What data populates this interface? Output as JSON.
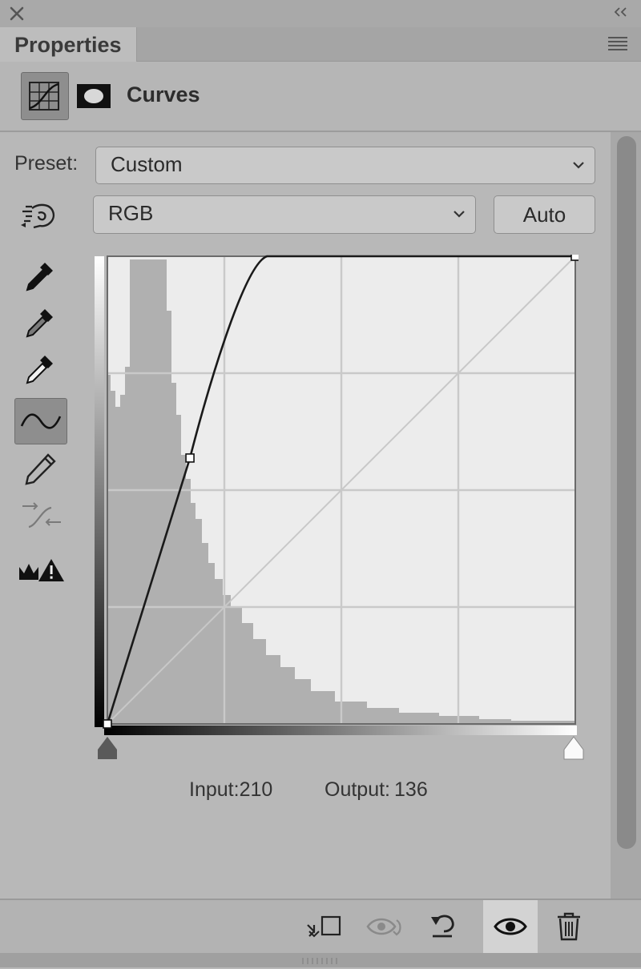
{
  "panel": {
    "tab_label": "Properties",
    "title": "Curves"
  },
  "preset": {
    "label": "Preset:",
    "value": "Custom"
  },
  "channel": {
    "value": "RGB",
    "auto_label": "Auto"
  },
  "curve": {
    "input_label": "Input:",
    "input_value": "210",
    "output_label": "Output:",
    "output_value": "136",
    "control_points": [
      {
        "input": 0,
        "output": 0
      },
      {
        "input": 45,
        "output": 145
      },
      {
        "input": 255,
        "output": 255
      }
    ]
  },
  "icons": {
    "close": "close-icon",
    "collapse": "double-chevron-left-icon",
    "menu": "hamburger-menu-icon",
    "adjustment": "curves-adjustment-icon",
    "mask": "layer-mask-icon",
    "target": "targeted-adjustment-hand-icon",
    "eyedropper_black": "black-point-eyedropper-icon",
    "eyedropper_gray": "gray-point-eyedropper-icon",
    "eyedropper_white": "white-point-eyedropper-icon",
    "points": "edit-points-curve-icon",
    "pencil": "pencil-draw-icon",
    "smooth": "smooth-curve-icon",
    "clipping": "clipping-warning-icon",
    "clip_to_layer": "clip-to-layer-icon",
    "previous_state": "view-previous-state-icon",
    "reset": "reset-icon",
    "visibility": "eye-icon",
    "delete": "trash-icon"
  }
}
